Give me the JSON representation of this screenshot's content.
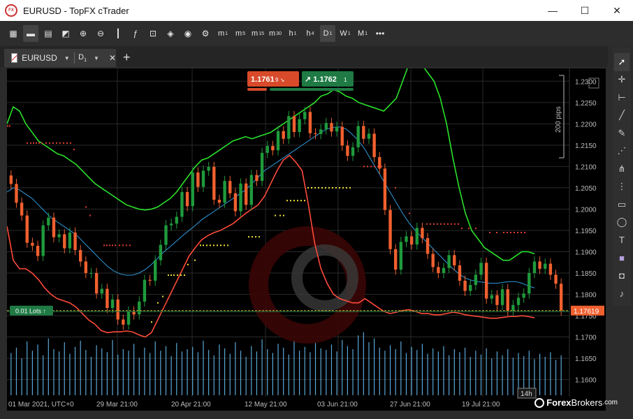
{
  "window": {
    "title": "EURUSD - TopFX cTrader",
    "icon": "topfx-icon",
    "controls": [
      "—",
      "☐",
      "✕"
    ]
  },
  "toolbar": {
    "tools": [
      {
        "name": "layout-grid-icon",
        "glyph": "▦"
      },
      {
        "name": "single-chart-icon",
        "glyph": "▬",
        "active": true
      },
      {
        "name": "multi-chart-icon",
        "glyph": "▤"
      },
      {
        "name": "chart-type-icon",
        "glyph": "◩"
      },
      {
        "name": "zoom-in-icon",
        "glyph": "⊕"
      },
      {
        "name": "zoom-out-icon",
        "glyph": "⊖"
      },
      {
        "name": "candles-icon",
        "glyph": "┃"
      },
      {
        "name": "indicators-icon",
        "glyph": "ƒ"
      },
      {
        "name": "robot-icon",
        "glyph": "⊡"
      },
      {
        "name": "layers-icon",
        "glyph": "◈"
      },
      {
        "name": "eye-icon",
        "glyph": "◉"
      },
      {
        "name": "chart-settings-icon",
        "glyph": "⚙"
      }
    ],
    "timeframes": [
      {
        "label": "m",
        "sub": "1"
      },
      {
        "label": "m",
        "sub": "5"
      },
      {
        "label": "m",
        "sub": "15"
      },
      {
        "label": "m",
        "sub": "30"
      },
      {
        "label": "h",
        "sub": "1"
      },
      {
        "label": "h",
        "sub": "4"
      },
      {
        "label": "D",
        "sub": "1",
        "active": true
      },
      {
        "label": "W",
        "sub": "1"
      },
      {
        "label": "M",
        "sub": "1"
      }
    ],
    "more": "•••"
  },
  "tab": {
    "symbol": "EURUSD",
    "timeframe": "D",
    "timeframe_sub": "1",
    "close": "✕",
    "add": "+"
  },
  "trade": {
    "sell_price": "1.1761",
    "sell_sup": "9",
    "buy_price": "1.1762",
    "buy_sup": "1",
    "lots": "0.01 Lots",
    "current_price": "1.17619",
    "pips_label": "200 pips",
    "countdown": "14h"
  },
  "colors": {
    "bull": "#1f9a3c",
    "bear": "#f0602f",
    "upper_band": "#2ae22a",
    "lower_band": "#ff4a3a",
    "middle_band": "#2e9bdd",
    "volume": "#5aa8d6",
    "grid": "#2a2a2a",
    "sell": "#d84a2a",
    "buy": "#1f7a44"
  },
  "sidebar": {
    "tools": [
      {
        "name": "cursor-icon",
        "glyph": "➚",
        "sel": true
      },
      {
        "name": "crosshair-icon",
        "glyph": "✛"
      },
      {
        "name": "ruler-icon",
        "glyph": "⊢"
      },
      {
        "name": "trendline-icon",
        "glyph": "╱"
      },
      {
        "name": "pen-icon",
        "glyph": "✎"
      },
      {
        "name": "fibonacci-icon",
        "glyph": "⋰"
      },
      {
        "name": "pitchfork-icon",
        "glyph": "⋔"
      },
      {
        "name": "fib-retracement-icon",
        "glyph": "⋮"
      },
      {
        "name": "rectangle-icon",
        "glyph": "▭"
      },
      {
        "name": "ellipse-icon",
        "glyph": "◯"
      },
      {
        "name": "text-icon",
        "glyph": "T"
      },
      {
        "name": "color-swatch-icon",
        "glyph": "■"
      },
      {
        "name": "camera-icon",
        "glyph": "◘"
      },
      {
        "name": "alert-bell-icon",
        "glyph": "♪"
      }
    ]
  },
  "watermark": {
    "text_bold": "Forex",
    "text": "Brokers",
    "suffix": ".com"
  },
  "chart_data": {
    "type": "candlestick",
    "symbol": "EURUSD",
    "timeframe": "D1",
    "y_ticks": [
      "1.2300",
      "1.2250",
      "1.2200",
      "1.2150",
      "1.2100",
      "1.2050",
      "1.2000",
      "1.1950",
      "1.1900",
      "1.1850",
      "1.1800",
      "1.1750",
      "1.1700",
      "1.1650",
      "1.1600"
    ],
    "x_ticks": [
      "01 Mar 2021, UTC+0",
      "29 Mar 21:00",
      "20 Apr 21:00",
      "12 May 21:00",
      "03 Jun 21:00",
      "27 Jun 21:00",
      "19 Jul 21:00"
    ],
    "ylim": [
      1.156,
      1.233
    ],
    "grid": true,
    "close": [
      1.2059,
      1.2015,
      1.1985,
      1.1921,
      1.1914,
      1.189,
      1.1962,
      1.198,
      1.1934,
      1.1941,
      1.1908,
      1.1945,
      1.1904,
      1.1877,
      1.185,
      1.185,
      1.1802,
      1.1813,
      1.1768,
      1.1788,
      1.1741,
      1.1729,
      1.176,
      1.1753,
      1.1783,
      1.1834,
      1.1832,
      1.188,
      1.1916,
      1.1962,
      1.1966,
      1.1982,
      1.204,
      1.2007,
      1.2086,
      1.2052,
      1.209,
      1.2099,
      1.2022,
      1.2015,
      1.2066,
      1.2037,
      1.1995,
      1.206,
      1.201,
      1.208,
      1.2066,
      1.2132,
      1.2148,
      1.2138,
      1.2183,
      1.2165,
      1.2218,
      1.2181,
      1.2211,
      1.2228,
      1.2178,
      1.2176,
      1.2187,
      1.2202,
      1.2182,
      1.2193,
      1.2149,
      1.2125,
      1.2145,
      1.2195,
      1.2165,
      1.2177,
      1.2122,
      1.2095,
      1.1998,
      1.1906,
      1.1858,
      1.1923,
      1.1936,
      1.1917,
      1.1956,
      1.1932,
      1.1895,
      1.1864,
      1.185,
      1.1862,
      1.1892,
      1.1868,
      1.1832,
      1.1808,
      1.1822,
      1.1846,
      1.1874,
      1.179,
      1.1798,
      1.1775,
      1.1812,
      1.1762,
      1.1775,
      1.1792,
      1.1802,
      1.185,
      1.1877,
      1.186,
      1.1872,
      1.1846,
      1.1825,
      1.1762
    ],
    "bb_upper": [
      1.22,
      1.224,
      1.223,
      1.22,
      1.218,
      1.216,
      1.215,
      1.214,
      1.213,
      1.2125,
      1.2115,
      1.2105,
      1.209,
      1.2075,
      1.206,
      1.205,
      1.204,
      1.203,
      1.202,
      1.201,
      1.2005,
      1.2,
      1.1998,
      1.2,
      1.2005,
      1.2015,
      1.2025,
      1.204,
      1.206,
      1.208,
      1.21,
      1.2115,
      1.212,
      1.213,
      1.214,
      1.215,
      1.216,
      1.2165,
      1.217,
      1.2165,
      1.217,
      1.2175,
      1.218,
      1.219,
      1.22,
      1.221,
      1.222,
      1.223,
      1.224,
      1.225,
      1.2265,
      1.227,
      1.228,
      1.2275,
      1.2265,
      1.226,
      1.225,
      1.2245,
      1.224,
      1.2235,
      1.223,
      1.2245,
      1.226,
      1.23,
      1.234,
      1.235,
      1.234,
      1.232,
      1.23,
      1.226,
      1.22,
      1.212,
      1.205,
      1.199,
      1.195,
      1.193,
      1.191,
      1.19,
      1.189,
      1.188,
      1.188,
      1.189,
      1.19,
      1.19,
      1.1895
    ],
    "bb_middle": [
      1.204,
      1.205,
      1.2045,
      1.2035,
      1.2025,
      1.201,
      1.1995,
      1.198,
      1.197,
      1.196,
      1.195,
      1.194,
      1.1925,
      1.191,
      1.1895,
      1.188,
      1.1866,
      1.1855,
      1.1848,
      1.1845,
      1.1845,
      1.185,
      1.1858,
      1.187,
      1.1885,
      1.19,
      1.1912,
      1.1925,
      1.1938,
      1.195,
      1.1962,
      1.1975,
      1.1985,
      1.1995,
      1.2005,
      1.2015,
      1.2025,
      1.2035,
      1.2045,
      1.206,
      1.2075,
      1.209,
      1.21,
      1.211,
      1.212,
      1.213,
      1.214,
      1.215,
      1.216,
      1.217,
      1.218,
      1.2188,
      1.2192,
      1.2193,
      1.2188,
      1.2175,
      1.216,
      1.214,
      1.2115,
      1.209,
      1.2065,
      1.204,
      1.2015,
      1.199,
      1.1968,
      1.195,
      1.1935,
      1.192,
      1.1905,
      1.189,
      1.1875,
      1.186,
      1.1848,
      1.1838,
      1.1833,
      1.183,
      1.1828,
      1.1826,
      1.1826,
      1.1828,
      1.183,
      1.183,
      1.1826,
      1.182,
      1.1815
    ],
    "bb_lower": [
      1.196,
      1.188,
      1.186,
      1.186,
      1.185,
      1.1835,
      1.1815,
      1.18,
      1.179,
      1.1785,
      1.178,
      1.177,
      1.1755,
      1.174,
      1.173,
      1.1715,
      1.171,
      1.1712,
      1.1712,
      1.1714,
      1.1712,
      1.1705,
      1.17,
      1.171,
      1.174,
      1.177,
      1.18,
      1.183,
      1.186,
      1.189,
      1.191,
      1.1928,
      1.1938,
      1.1945,
      1.195,
      1.1958,
      1.1966,
      1.1978,
      1.199,
      1.2,
      1.201,
      1.203,
      1.206,
      1.209,
      1.2115,
      1.2126,
      1.211,
      1.209,
      1.201,
      1.192,
      1.186,
      1.1825,
      1.18,
      1.179,
      1.1785,
      1.178,
      1.178,
      1.179,
      1.178,
      1.177,
      1.176,
      1.1755,
      1.1758,
      1.1762,
      1.1764,
      1.176,
      1.1755,
      1.1755,
      1.1752,
      1.1752,
      1.1755,
      1.1758,
      1.1756,
      1.1752,
      1.175,
      1.1748,
      1.1746,
      1.1744,
      1.1744,
      1.1746,
      1.1748,
      1.1748,
      1.175,
      1.1748,
      1.1745
    ],
    "volume": [
      0.55,
      0.62,
      0.48,
      0.7,
      0.58,
      0.66,
      0.52,
      0.74,
      0.6,
      0.57,
      0.69,
      0.54,
      0.63,
      0.71,
      0.59,
      0.5,
      0.65,
      0.61,
      0.56,
      0.72,
      0.53,
      0.6,
      0.58,
      0.67,
      0.49,
      0.62,
      0.55,
      0.7,
      0.58,
      0.64,
      0.51,
      0.68,
      0.57,
      0.6,
      0.63,
      0.56,
      0.71,
      0.59,
      0.52,
      0.66,
      0.61,
      0.54,
      0.69,
      0.58,
      0.5,
      0.64,
      0.57,
      0.73,
      0.6,
      0.55,
      0.67,
      0.62,
      0.53,
      0.7,
      0.58,
      0.63,
      0.56,
      0.68,
      0.61,
      0.59,
      0.66,
      0.57,
      0.72,
      0.64,
      0.6,
      0.78,
      0.82,
      0.69,
      0.74,
      0.62,
      0.58,
      0.65,
      0.6,
      0.7,
      0.55,
      0.63,
      0.59,
      0.67,
      0.54,
      0.61,
      0.57,
      0.64,
      0.52,
      0.6,
      0.56,
      0.62,
      0.5,
      0.58,
      0.53,
      0.61,
      0.48,
      0.57,
      0.52,
      0.6,
      0.49,
      0.55,
      0.51,
      0.58,
      0.47,
      0.54,
      0.5,
      0.56,
      0.46,
      0.52
    ]
  }
}
